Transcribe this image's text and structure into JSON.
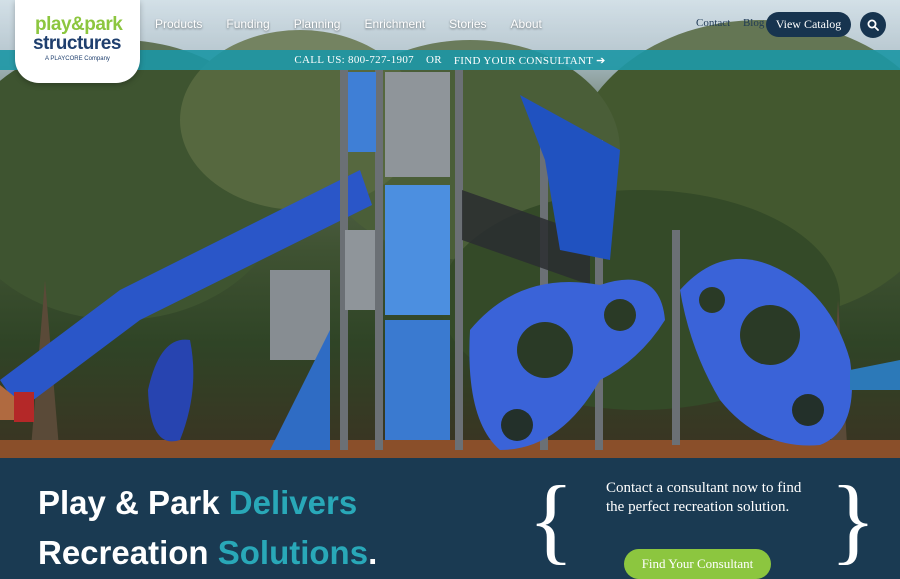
{
  "logo": {
    "top": "play&park",
    "bottom": "structures",
    "sub": "A PLAYCORE Company"
  },
  "nav": {
    "items": [
      "Products",
      "Funding",
      "Planning",
      "Enrichment",
      "Stories",
      "About"
    ]
  },
  "toplinks": {
    "contact": "Contact",
    "blog": "Blog"
  },
  "catalog_button": "View Catalog",
  "search_icon": "search-icon",
  "callbar": {
    "phone": "CALL US: 800-727-1907",
    "or": "OR",
    "find": "FIND YOUR CONSULTANT ➔"
  },
  "headline": {
    "part1": "Play & Park ",
    "accent1": "Delivers",
    "part2": "Recreation ",
    "accent2": "Solutions",
    "end": "."
  },
  "contact": {
    "text": "Contact a consultant now to find the perfect recreation solution.",
    "button": "Find Your Consultant"
  },
  "colors": {
    "navy": "#17344f",
    "teal": "#29a8b8",
    "green": "#8cc63f",
    "bottom_bg": "#1a3a52"
  }
}
